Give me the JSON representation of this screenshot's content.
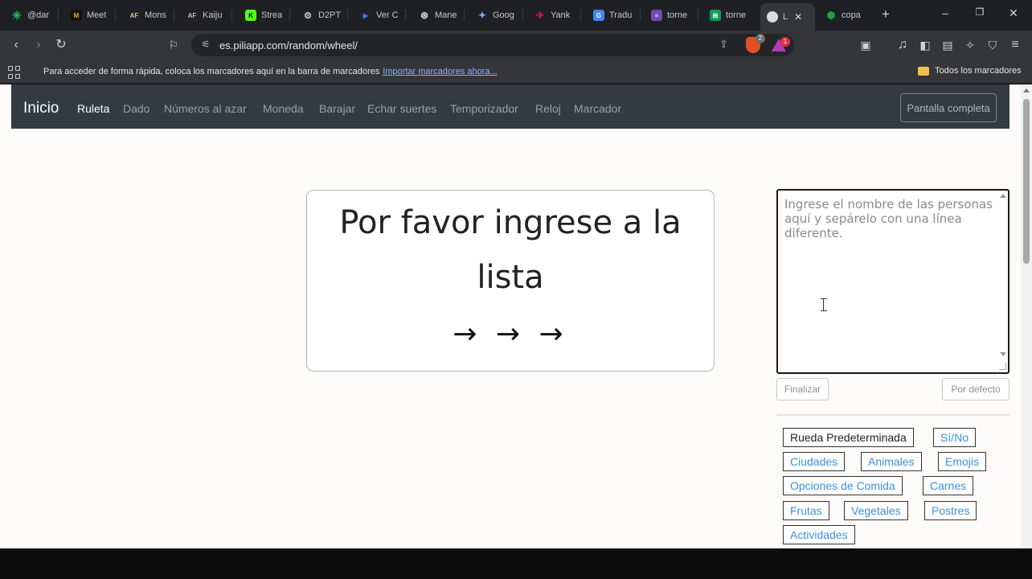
{
  "browser": {
    "tabs": [
      {
        "label": "@dar",
        "icon": "sparkle-icon",
        "color": "#22c55e"
      },
      {
        "label": "Meet",
        "icon": "meet-icon",
        "color": "#111111"
      },
      {
        "label": "Mons",
        "icon": "af-icon",
        "color": "#333333"
      },
      {
        "label": "Kaiju",
        "icon": "af-icon",
        "color": "#333333"
      },
      {
        "label": "Strea",
        "icon": "kick-icon",
        "color": "#53fc18"
      },
      {
        "label": "D2PT",
        "icon": "d2pt-icon",
        "color": "#444444"
      },
      {
        "label": "Ver C",
        "icon": "play-icon",
        "color": "#1e3a8a"
      },
      {
        "label": "Mane",
        "icon": "chatgpt-icon",
        "color": "#555555"
      },
      {
        "label": "Goog",
        "icon": "gemini-icon",
        "color": "#4285f4"
      },
      {
        "label": "Yank",
        "icon": "yankees-icon",
        "color": "#c8102e"
      },
      {
        "label": "Tradu",
        "icon": "translate-icon",
        "color": "#4285f4"
      },
      {
        "label": "torne",
        "icon": "forms-icon",
        "color": "#7248b9"
      },
      {
        "label": "torne",
        "icon": "sheets-icon",
        "color": "#0f9d58"
      },
      {
        "label": "L",
        "icon": "piliapp-icon",
        "color": "#bbbbbb"
      },
      {
        "label": "copa",
        "icon": "copa-icon",
        "color": "#16a34a"
      }
    ],
    "new_tab": "+",
    "url": "es.piliapp.com/random/wheel/",
    "brave_badge": "2",
    "rewards_badge": "1",
    "bookmarks_hint": "Para acceder de forma rápida, coloca los marcadores aquí en la barra de marcadores",
    "bookmarks_import": "Importar marcadores ahora...",
    "bookmarks_folder": "Todos los marcadores"
  },
  "nav": {
    "brand": "Inicio",
    "links": [
      "Ruleta",
      "Dado",
      "Números al azar",
      "Moneda",
      "Barajar",
      "Echar suertes",
      "Temporizador",
      "Reloj",
      "Marcador"
    ],
    "fullscreen": "Pantalla completa"
  },
  "wheel": {
    "prompt": "Por favor ingrese a la lista",
    "arrows": "→ → →"
  },
  "editor": {
    "placeholder": "Ingrese el nombre de las personas aquí y sepárelo con una línea diferente.",
    "value": "",
    "finish": "Finalizar",
    "default": "Por defecto"
  },
  "presets": [
    "Rueda Predeterminada",
    "Sí/No",
    "Ciudades",
    "Animales",
    "Emojis",
    "Opciones de Comida",
    "Carnes",
    "Frutas",
    "Vegetales",
    "Postres",
    "Actividades"
  ],
  "colors": {
    "navbar": "#343a40",
    "link": "#3d8fe0",
    "page_bg": "#fdfbfa"
  }
}
